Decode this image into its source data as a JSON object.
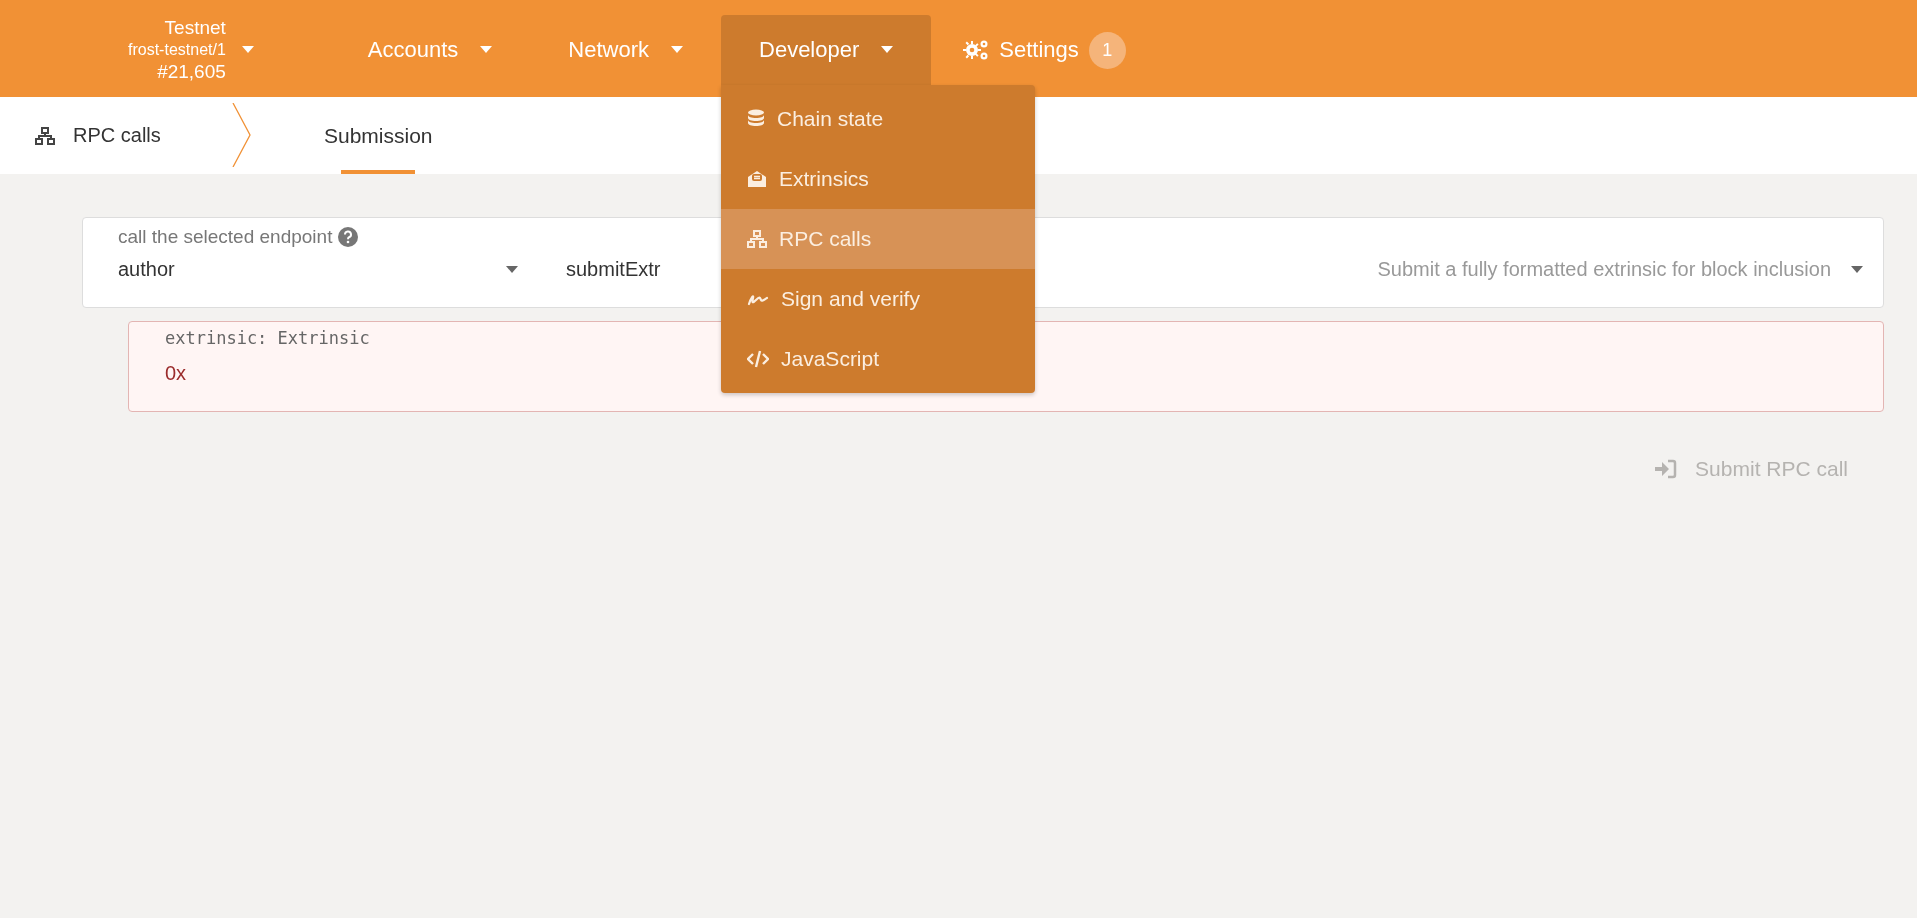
{
  "header": {
    "chain": {
      "name": "Testnet",
      "node": "frost-testnet/1",
      "block": "#21,605"
    },
    "menus": [
      {
        "label": "Accounts",
        "expanded": false
      },
      {
        "label": "Network",
        "expanded": false
      },
      {
        "label": "Developer",
        "expanded": true,
        "items": [
          {
            "label": "Chain state",
            "selected": false
          },
          {
            "label": "Extrinsics",
            "selected": false
          },
          {
            "label": "RPC calls",
            "selected": true
          },
          {
            "label": "Sign and verify",
            "selected": false
          },
          {
            "label": "JavaScript",
            "selected": false
          }
        ]
      }
    ],
    "settings": {
      "label": "Settings",
      "badge": "1"
    }
  },
  "subnav": {
    "section": "RPC calls",
    "tabs": [
      {
        "label": "Submission",
        "selected": true
      }
    ]
  },
  "form": {
    "label": "call the selected endpoint",
    "module": "author",
    "method": "submitExtr",
    "description": "Submit a fully formatted extrinsic for block inclusion",
    "param": {
      "label": "extrinsic: Extrinsic",
      "value": "0x",
      "invalid": true
    },
    "submit": {
      "label": "Submit RPC call",
      "disabled": true
    }
  }
}
